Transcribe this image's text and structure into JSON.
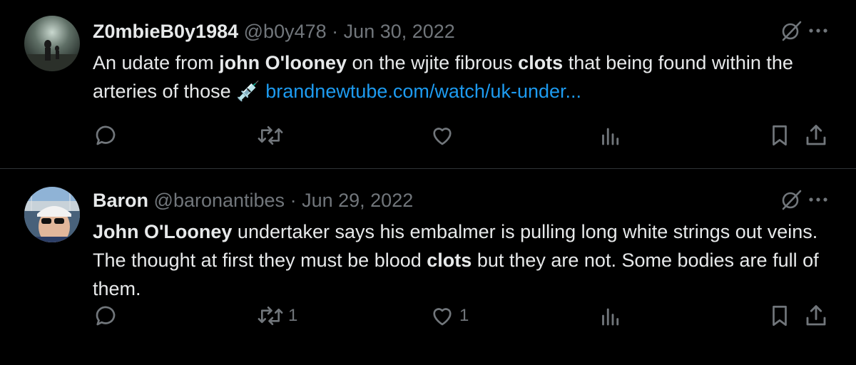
{
  "tweets": [
    {
      "display_name": "Z0mbieB0y1984",
      "handle": "@b0y478",
      "separator": "·",
      "date": "Jun 30, 2022",
      "text": {
        "p1": "An udate from ",
        "b1": "john O'looney",
        "p2": " on the wjite fibrous ",
        "b2": "clots",
        "p3": " that being found within the arteries of those ",
        "emoji": "💉",
        "link": "brandnewtube.com/watch/uk-under..."
      },
      "counts": {
        "reply": "",
        "retweet": "",
        "like": "",
        "views": ""
      }
    },
    {
      "display_name": "Baron",
      "handle": "@baronantibes",
      "separator": "·",
      "date": "Jun 29, 2022",
      "text": {
        "b1": "John O'Looney",
        "p1": " undertaker says his embalmer is pulling long white strings out veins.  The thought at first they must be blood ",
        "b2": "clots",
        "p2": " but they are not. Some bodies are full of them."
      },
      "counts": {
        "reply": "",
        "retweet": "1",
        "like": "1",
        "views": ""
      }
    }
  ],
  "icons": {
    "grok": "grok-icon",
    "more": "more-icon",
    "reply": "reply-icon",
    "retweet": "retweet-icon",
    "like": "like-icon",
    "views": "views-icon",
    "bookmark": "bookmark-icon",
    "share": "share-icon"
  },
  "colors": {
    "background": "#000000",
    "text": "#e7e9ea",
    "muted": "#71767b",
    "link": "#1d9bf0",
    "divider": "#2f3336"
  }
}
